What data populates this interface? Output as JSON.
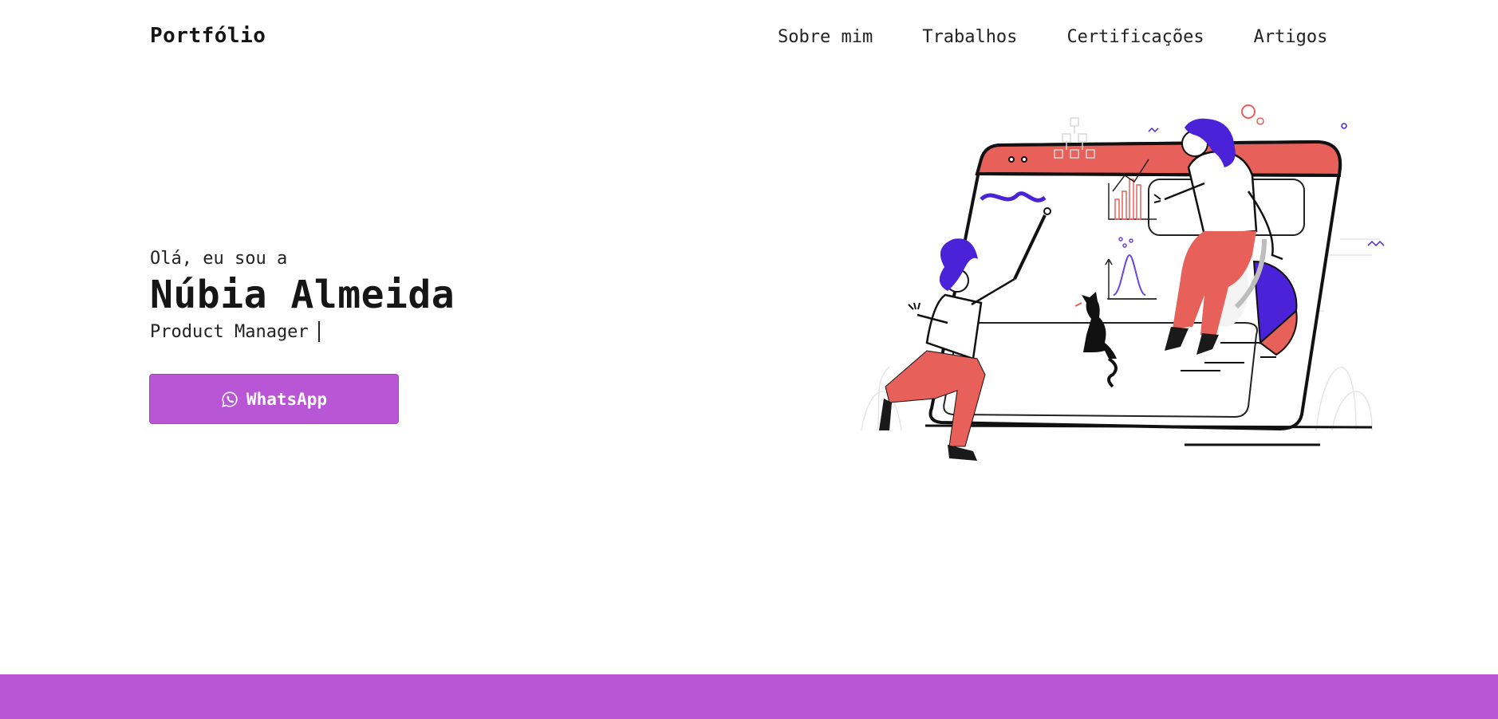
{
  "header": {
    "brand": "Portfólio",
    "nav": [
      {
        "label": "Sobre mim"
      },
      {
        "label": "Trabalhos"
      },
      {
        "label": "Certificações"
      },
      {
        "label": "Artigos"
      }
    ]
  },
  "hero": {
    "greeting": "Olá, eu sou a",
    "name": "Núbia Almeida",
    "role": "Product Manager",
    "cta": {
      "label": "WhatsApp",
      "icon": "whatsapp-icon"
    }
  },
  "colors": {
    "accent": "#b956d5",
    "illustration_red": "#e8605a",
    "illustration_purple": "#4a22d8",
    "text": "#1c1c1c"
  }
}
